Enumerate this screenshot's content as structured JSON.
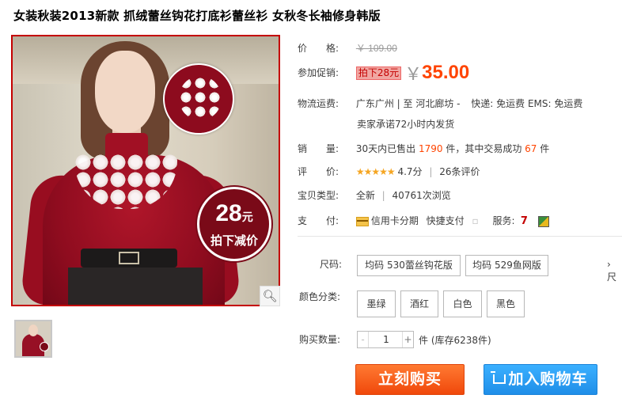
{
  "title": "女装秋装2013新款 抓绒蕾丝钩花打底衫蕾丝衫 女秋冬长袖修身韩版",
  "image_badge": {
    "number": "28",
    "unit": "元",
    "text": "拍下减价"
  },
  "price": {
    "label": "价　　格:",
    "original": "￥ 109.00"
  },
  "promo": {
    "label": "参加促销:",
    "tag": "拍下28元",
    "currency": "￥",
    "amount": "35.00"
  },
  "shipping": {
    "label": "物流运费:",
    "route": "广东广州 | 至  河北廊坊 -",
    "express": "快递: 免运费   EMS: 免运费",
    "promise": "卖家承诺72小时内发货"
  },
  "sales": {
    "label": "销　　量:",
    "prefix": "30天内已售出",
    "sold": "1790",
    "mid": "件，其中交易成功",
    "success": "67",
    "suffix": "件"
  },
  "rating": {
    "label": "评　　价:",
    "stars": "★★★★★",
    "score": "4.7分",
    "sep": "|",
    "reviews": "26条评价"
  },
  "item_type": {
    "label": "宝贝类型:",
    "condition": "全新",
    "sep": "|",
    "views": "40761次浏览"
  },
  "payment": {
    "label": "支　　付:",
    "installment": "信用卡分期",
    "quick": "快捷支付",
    "service_label": "服务:",
    "service_icon_text": "7"
  },
  "size": {
    "label": "尺码:",
    "options": [
      "均码 530蕾丝钩花版",
      "均码 529鱼网版"
    ],
    "more": "› 尺"
  },
  "color": {
    "label": "颜色分类:",
    "options": [
      "墨绿",
      "酒红",
      "白色",
      "黑色"
    ]
  },
  "quantity": {
    "label": "购买数量:",
    "value": "1",
    "minus": "-",
    "plus": "+",
    "stock": "件 (库存6238件)"
  },
  "actions": {
    "buy_now": "立刻购买",
    "add_to_cart": "加入购物车"
  }
}
